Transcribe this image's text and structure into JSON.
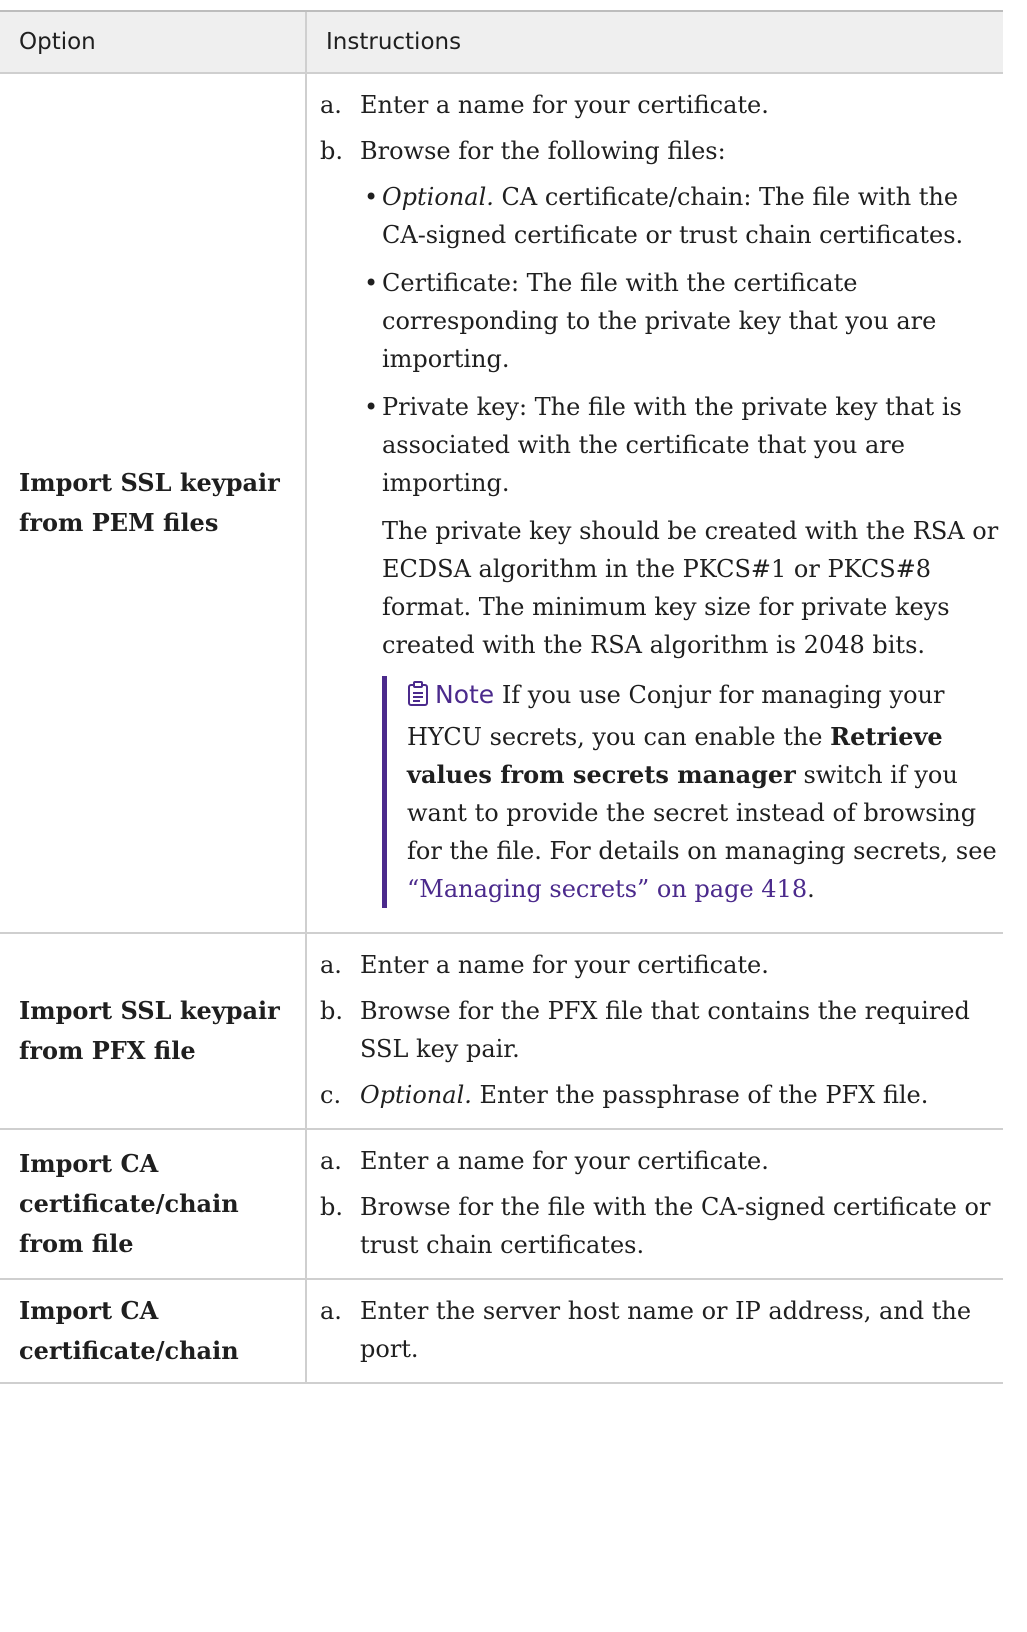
{
  "headers": {
    "option": "Option",
    "instructions": "Instructions"
  },
  "rows": [
    {
      "option": "Import SSL keypair from PEM files",
      "steps": [
        {
          "marker": "a.",
          "text": "Enter a name for your certificate."
        },
        {
          "marker": "b.",
          "text": "Browse for the following files:",
          "bullets": [
            {
              "em": "Optional.",
              "text": " CA certificate/chain: The file with the CA-signed certificate or trust chain certificates."
            },
            {
              "text": "Certificate: The file with the certificate corresponding to the private key that you are importing."
            },
            {
              "text": "Private key: The file with the private key that is associated with the certificate that you are importing."
            }
          ],
          "paragraph": "The private key should be created with the RSA or ECDSA algorithm in the PKCS#1 or PKCS#8 format. The minimum key size for private keys created with the RSA algorithm is 2048 bits.",
          "note": {
            "label": "Note",
            "icon": "clipboard-note-icon",
            "text_before": " If you use Conjur for managing your HYCU secrets, you can enable the ",
            "bold": "Retrieve values from secrets manager",
            "text_after": " switch if you want to provide the secret instead of browsing for the file. For details on managing secrets, see ",
            "link": "“Managing secrets” on page 418",
            "end": "."
          }
        }
      ]
    },
    {
      "option": "Import SSL keypair from PFX file",
      "steps": [
        {
          "marker": "a.",
          "text": "Enter a name for your certificate."
        },
        {
          "marker": "b.",
          "text": "Browse for the PFX file that contains the required SSL key pair."
        },
        {
          "marker": "c.",
          "em": "Optional.",
          "text": " Enter the passphrase of the PFX file."
        }
      ]
    },
    {
      "option": "Import CA certificate/chain from file",
      "steps": [
        {
          "marker": "a.",
          "text": "Enter a name for your certificate."
        },
        {
          "marker": "b.",
          "text": "Browse for the file with the CA-signed certificate or trust chain certificates."
        }
      ]
    },
    {
      "option": "Import CA certificate/chain",
      "steps": [
        {
          "marker": "a.",
          "text": "Enter the server host name or IP address, and the port."
        }
      ]
    }
  ],
  "colors": {
    "accent": "#4b2a8c",
    "header_bg": "#efefef",
    "border": "#cfcfcf"
  }
}
